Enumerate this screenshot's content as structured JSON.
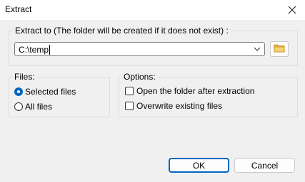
{
  "window": {
    "title": "Extract",
    "close_icon": "close-icon"
  },
  "extract_to": {
    "label": "Extract to (The folder will be created if it does not exist) :",
    "path_value": "C:\\temp",
    "dropdown_icon": "chevron-down-icon",
    "browse_icon": "folder-icon"
  },
  "files": {
    "label": "Files:",
    "options": [
      {
        "label": "Selected files",
        "selected": true
      },
      {
        "label": "All files",
        "selected": false
      }
    ]
  },
  "options": {
    "label": "Options:",
    "checkboxes": [
      {
        "label": "Open the folder after extraction",
        "checked": false
      },
      {
        "label": "Overwrite existing files",
        "checked": false
      }
    ]
  },
  "buttons": {
    "ok": "OK",
    "cancel": "Cancel"
  },
  "colors": {
    "accent": "#0067c0",
    "folder": "#e8b84a"
  }
}
